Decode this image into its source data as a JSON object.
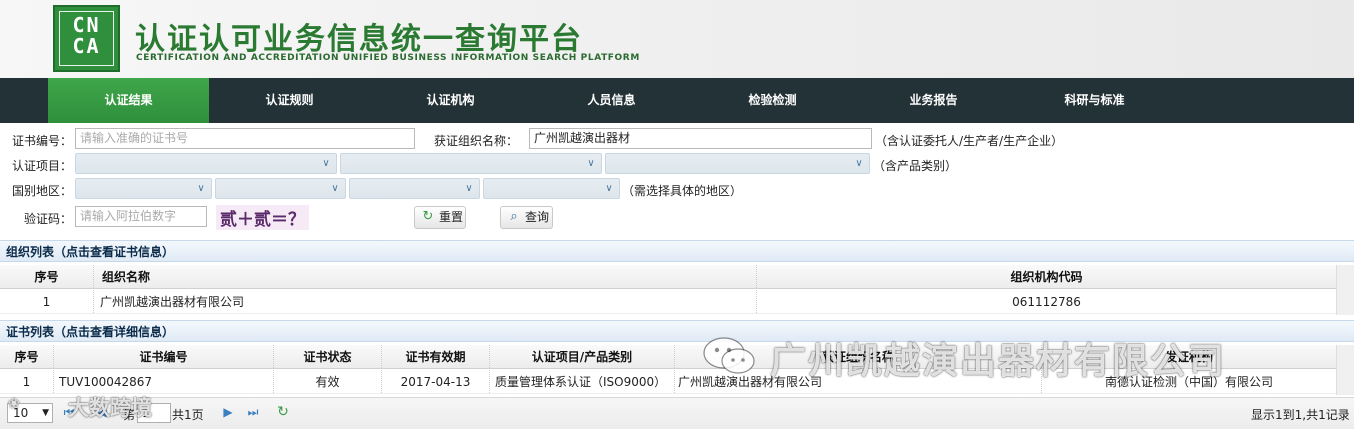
{
  "header": {
    "logo_text": "CN\nCA",
    "title_cn": "认证认可业务信息统一查询平台",
    "title_en": "CERTIFICATION AND ACCREDITATION UNIFIED BUSINESS INFORMATION SEARCH PLATFORM"
  },
  "nav": {
    "items": [
      {
        "label": "认证结果",
        "active": true
      },
      {
        "label": "认证规则"
      },
      {
        "label": "认证机构"
      },
      {
        "label": "人员信息"
      },
      {
        "label": "检验检测"
      },
      {
        "label": "业务报告"
      },
      {
        "label": "科研与标准"
      }
    ]
  },
  "form": {
    "cert_no_label": "证书编号：",
    "cert_no_placeholder": "请输入准确的证书号",
    "org_label": "获证组织名称：",
    "org_value": "广州凯越演出器材",
    "org_hint": "（含认证委托人/生产者/生产企业）",
    "project_label": "认证项目：",
    "project_hint": "（含产品类别）",
    "region_label": "国别地区：",
    "region_hint": "（需选择具体的地区）",
    "captcha_label": "验证码：",
    "captcha_placeholder": "请输入阿拉伯数字",
    "captcha_question": "贰＋贰＝？",
    "reset_label": "重置",
    "query_label": "查询"
  },
  "org_panel": {
    "title": "组织列表（点击查看证书信息）",
    "columns": [
      "序号",
      "组织名称",
      "组织机构代码"
    ],
    "rows": [
      {
        "no": "1",
        "name": "广州凯越演出器材有限公司",
        "code": "061112786"
      }
    ]
  },
  "cert_panel": {
    "title": "证书列表（点击查看详细信息）",
    "columns": [
      "序号",
      "证书编号",
      "证书状态",
      "证书有效期",
      "认证项目/产品类别",
      "获证组织名称",
      "发证机构"
    ],
    "rows": [
      {
        "no": "1",
        "cert_no": "TUV100042867",
        "status": "有效",
        "valid_until": "2017-04-13",
        "project": "质量管理体系认证（ISO9000）",
        "org": "广州凯越演出器材有限公司",
        "issuer": "南德认证检测（中国）有限公司"
      }
    ]
  },
  "pager": {
    "page_size": "10",
    "page_label": "第",
    "page_value": "1",
    "page_total": "共1页",
    "summary": "显示1到1,共1记录"
  },
  "watermarks": {
    "left": "大数跨境",
    "right": "广州凯越演出器材有限公司"
  },
  "colors": {
    "brand_green": "#2f8f3c",
    "nav_bg": "#233236",
    "panel_head": "#dfeaf5"
  }
}
